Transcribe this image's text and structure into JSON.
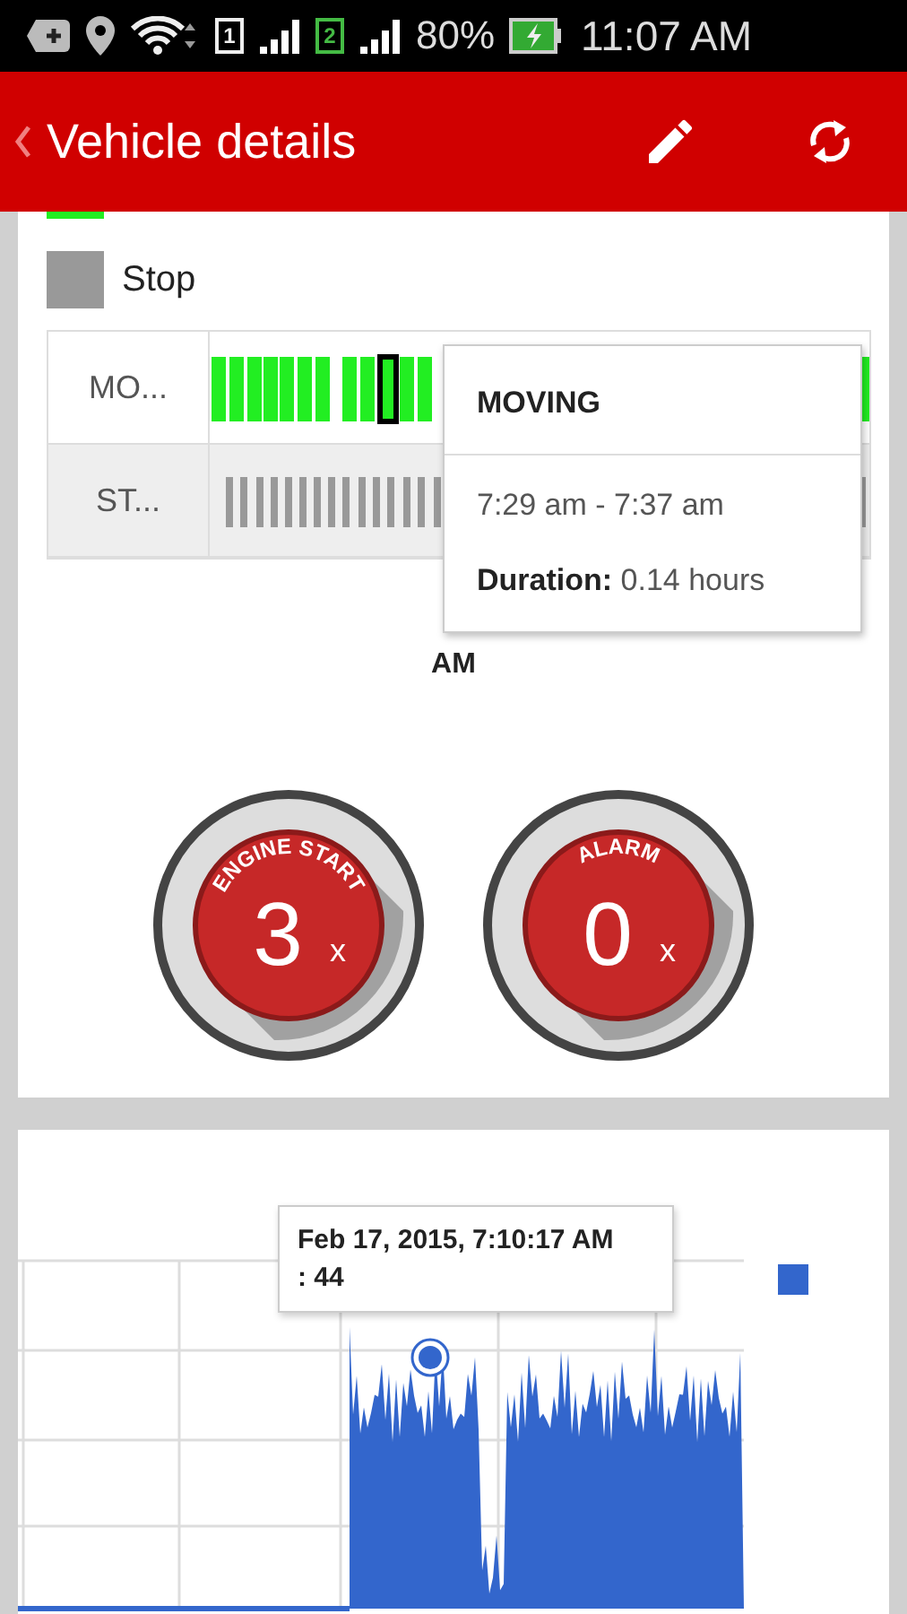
{
  "status_bar": {
    "sim_slots": [
      "1",
      "2"
    ],
    "battery": "80%",
    "time": "11:07 AM"
  },
  "app_bar": {
    "title": "Vehicle details"
  },
  "legend": [
    {
      "color": "#22ee22"
    },
    {
      "label": "Stop",
      "color": "#999999"
    }
  ],
  "timeline": {
    "rows": [
      {
        "label": "MO...",
        "color": "#22ee22"
      },
      {
        "label": "ST...",
        "color": "#999999"
      }
    ],
    "axis_label": "AM",
    "tooltip": {
      "title": "MOVING",
      "time_range": "7:29 am - 7:37 am",
      "duration_label": "Duration:",
      "duration_value": "0.14 hours"
    }
  },
  "counters": [
    {
      "label": "ENGINE START",
      "count": "3",
      "unit": "x"
    },
    {
      "label": "ALARM",
      "count": "0",
      "unit": "x"
    }
  ],
  "chart": {
    "tooltip": {
      "date": "Feb 17, 2015, 7:10:17 AM",
      "value": ": 44"
    }
  }
}
